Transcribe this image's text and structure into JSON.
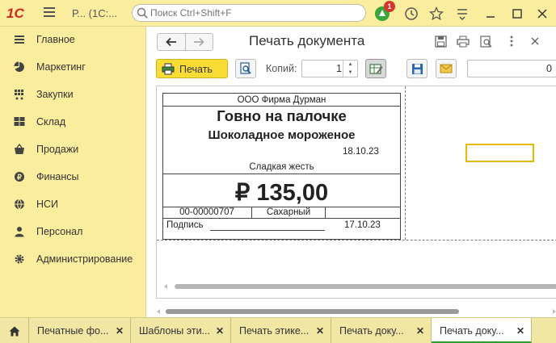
{
  "app": {
    "logo_text": "1С",
    "title": "Р... (1С:..."
  },
  "search": {
    "placeholder": "Поиск Ctrl+Shift+F"
  },
  "notifications": {
    "count": "1"
  },
  "sidebar": {
    "items": [
      {
        "label": "Главное",
        "icon": "list-icon"
      },
      {
        "label": "Маркетинг",
        "icon": "pie-chart-icon"
      },
      {
        "label": "Закупки",
        "icon": "cart-icon"
      },
      {
        "label": "Склад",
        "icon": "warehouse-grid-icon"
      },
      {
        "label": "Продажи",
        "icon": "basket-icon"
      },
      {
        "label": "Финансы",
        "icon": "coin-icon"
      },
      {
        "label": "НСИ",
        "icon": "globe-icon"
      },
      {
        "label": "Персонал",
        "icon": "person-icon"
      },
      {
        "label": "Администрирование",
        "icon": "gear-icon"
      }
    ]
  },
  "form": {
    "title": "Печать документа",
    "print_button": "Печать",
    "copies_label": "Копий:",
    "copies_value": "1",
    "number_value": "0"
  },
  "label": {
    "company": "ООО Фирма Дурман",
    "product_name": "Говно на палочке",
    "product_subtitle": "Шоколадное мороженое",
    "date_top": "18.10.23",
    "slogan": "Сладкая жесть",
    "price": "₽ 135,00",
    "code": "00-00000707",
    "attribute": "Сахарный",
    "signature_label": "Подпись",
    "date_bottom": "17.10.23"
  },
  "tabs": [
    {
      "label": "Печатные фо...",
      "active": false
    },
    {
      "label": "Шаблоны эти...",
      "active": false
    },
    {
      "label": "Печать этике...",
      "active": false
    },
    {
      "label": "Печать доку...",
      "active": false
    },
    {
      "label": "Печать доку...",
      "active": true
    }
  ],
  "colors": {
    "panel_bg": "#fbed9e",
    "print_button": "#f9dc34",
    "active_tab_underline": "#29a329",
    "badge": "#d9342b",
    "selection": "#e6b800"
  }
}
